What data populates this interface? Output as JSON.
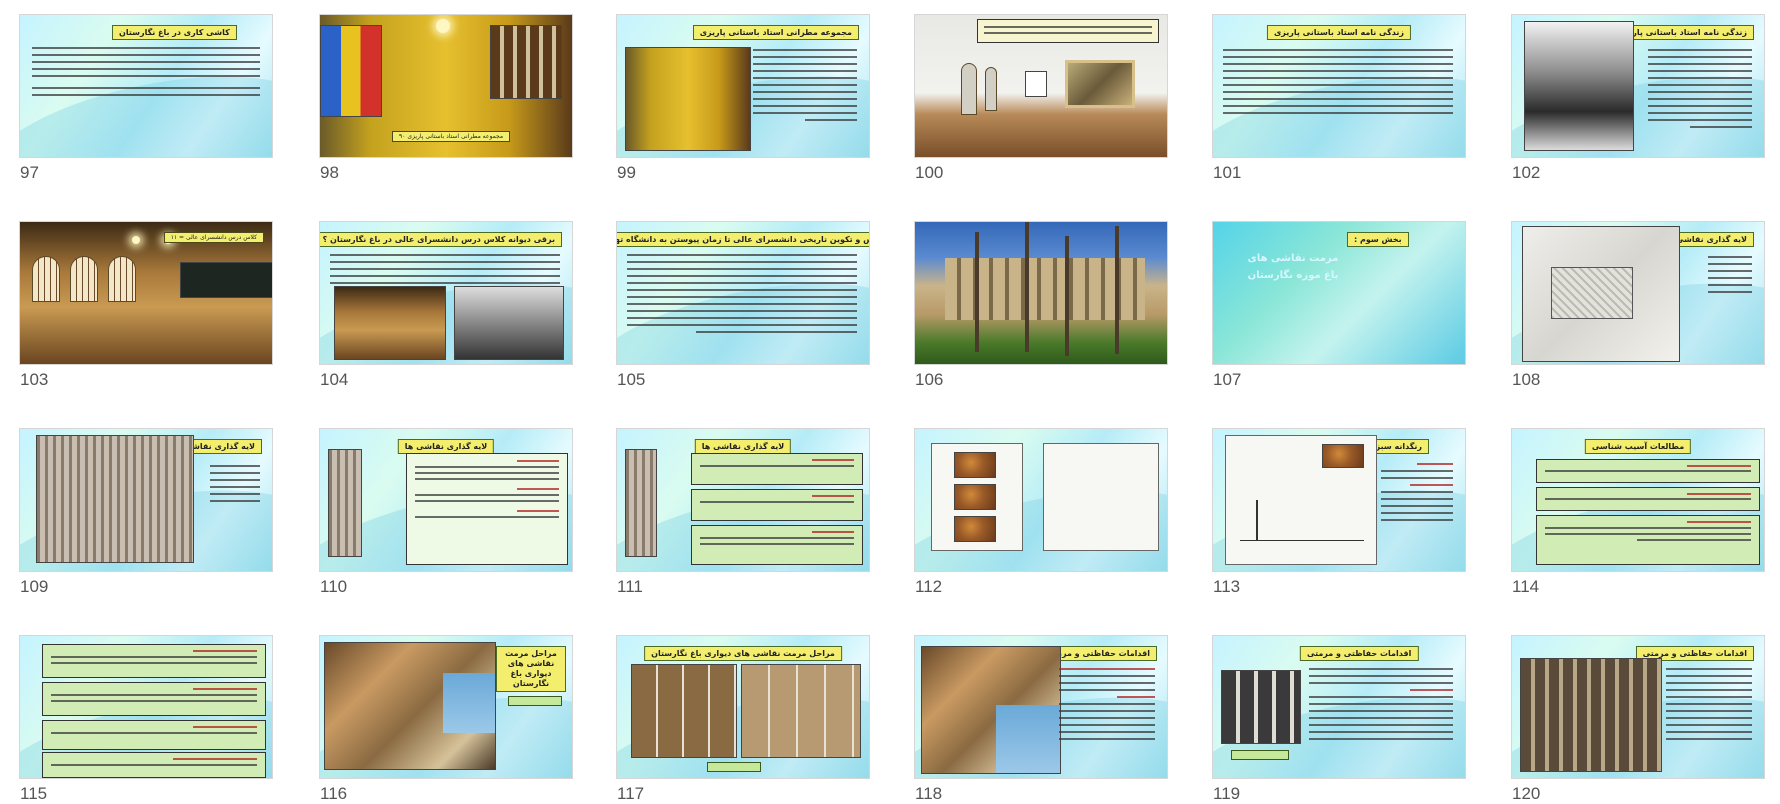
{
  "slides": [
    {
      "number": "97",
      "title": "کاشی کاری در باغ نگارستان"
    },
    {
      "number": "98",
      "title": "۹۰ مجموعه مطرانی استاد باستانی پاریزی"
    },
    {
      "number": "99",
      "title": "مجموعه مطرانی استاد باستانی پاریزی"
    },
    {
      "number": "100",
      "title": ""
    },
    {
      "number": "101",
      "title": "زندگی نامه استاد باستانی پاریزی"
    },
    {
      "number": "102",
      "title": "زندگی نامه استاد باستانی پاریزی"
    },
    {
      "number": "103",
      "title": "۱۱ = کلاس درس دانشسرای عالی"
    },
    {
      "number": "104",
      "title": "برقی دیوانه کلاس درس دانشسرای عالی در باغ نگارستان ؟"
    },
    {
      "number": "105",
      "title": "تاسیس و تکوین تاریخی دانشسرای عالی تا زمان پیوستن به دانشگاه تهران :"
    },
    {
      "number": "106",
      "title": ""
    },
    {
      "number": "107",
      "title": "بخش سوم :",
      "subtitle": "مرمت نقاشی های باغ موزه نگارستان"
    },
    {
      "number": "108",
      "title": "لایه گذاری نقاشی ها"
    },
    {
      "number": "109",
      "title": "لایه گذاری نقاشی ها"
    },
    {
      "number": "110",
      "title": "لایه گذاری نقاشی ها"
    },
    {
      "number": "111",
      "title": "لایه گذاری نقاشی ها"
    },
    {
      "number": "112",
      "title": ""
    },
    {
      "number": "113",
      "title": "رنگدانه سبز"
    },
    {
      "number": "114",
      "title": "مطالعات آسیب شناسی"
    },
    {
      "number": "115",
      "title": ""
    },
    {
      "number": "116",
      "title": "مراحل مرمت نقاشی های دیواری باغ نگارستان"
    },
    {
      "number": "117",
      "title": "مراحل مرمت نقاشی های دیواری باغ نگارستان"
    },
    {
      "number": "118",
      "title": "اقدامات حفاظتی و مرمتی"
    },
    {
      "number": "119",
      "title": "اقدامات حفاظتی و مرمتی"
    },
    {
      "number": "120",
      "title": "اقدامات حفاظتی و مرمتی"
    }
  ],
  "icons": {
    "light": "ceiling-light-icon"
  }
}
